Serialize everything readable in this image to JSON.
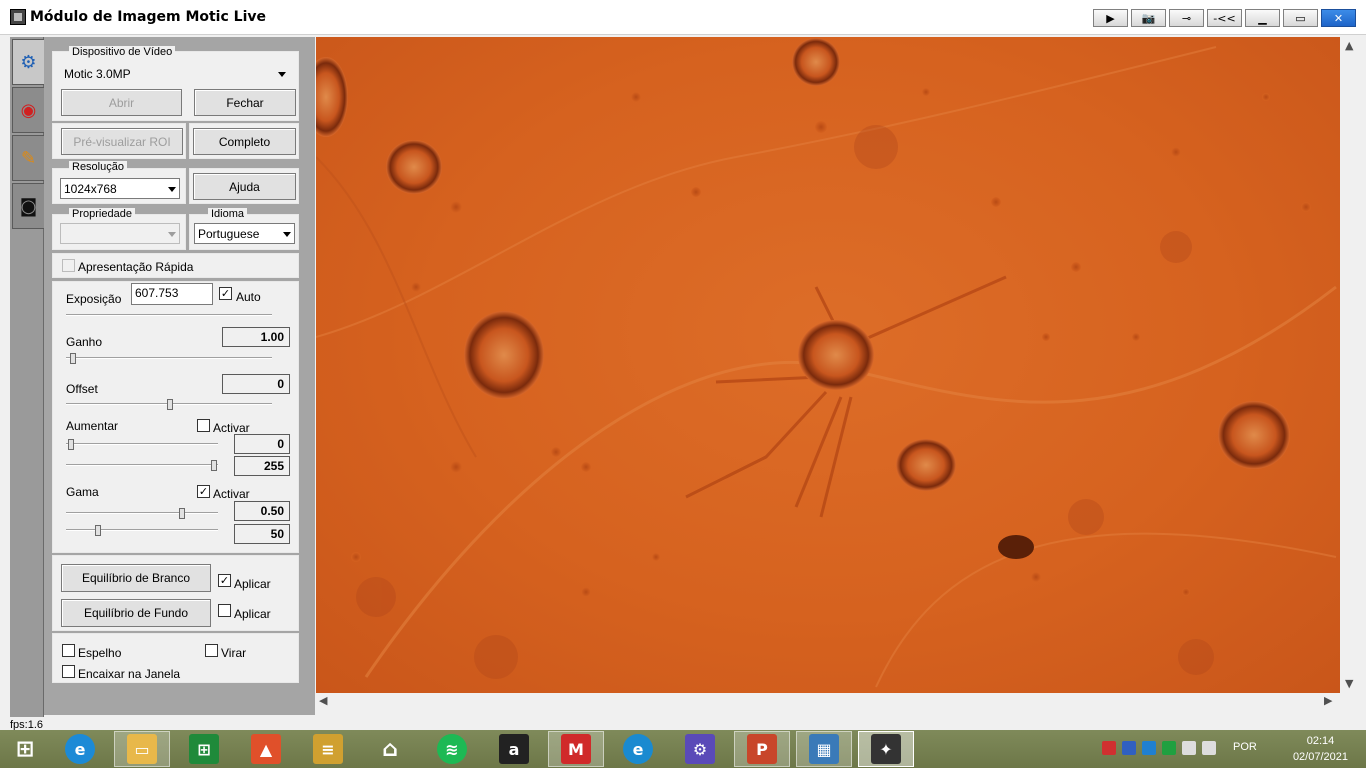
{
  "window": {
    "title": "Módulo de Imagem Motic Live",
    "buttons": [
      "play-button",
      "camera-button",
      "pin-button",
      "collapse-button",
      "minimize-button",
      "maximize-button",
      "close-button"
    ]
  },
  "tabs": [
    {
      "icon": "download-settings-icon",
      "active": true
    },
    {
      "icon": "color-wheel-icon",
      "active": false
    },
    {
      "icon": "tools-icon",
      "active": false
    },
    {
      "icon": "camera-icon",
      "active": false
    }
  ],
  "video_device": {
    "group_label": "Dispositivo de Vídeo",
    "device": "Motic 3.0MP",
    "open_label": "Abrir",
    "close_label": "Fechar",
    "roi_label": "Pré-visualizar ROI",
    "full_label": "Completo"
  },
  "resolution": {
    "group_label": "Resolução",
    "value": "1024x768",
    "help_label": "Ajuda"
  },
  "property": {
    "group_label": "Propriedade",
    "value": ""
  },
  "language": {
    "group_label": "Idioma",
    "value": "Portuguese"
  },
  "quick_display": {
    "label": "Apresentação Rápida",
    "checked": false
  },
  "exposure": {
    "label": "Exposição",
    "value": "607.753",
    "auto_label": "Auto",
    "auto_checked": true
  },
  "gain": {
    "label": "Ganho",
    "value": "1.00"
  },
  "offset": {
    "label": "Offset",
    "value": "0"
  },
  "enhance": {
    "label": "Aumentar",
    "activate_label": "Activar",
    "activate_checked": false,
    "min_value": "0",
    "max_value": "255"
  },
  "gamma": {
    "label": "Gama",
    "activate_label": "Activar",
    "activate_checked": true,
    "value1": "0.50",
    "value2": "50"
  },
  "white_balance": {
    "button_label": "Equilíbrio de Branco",
    "apply_label": "Aplicar",
    "apply_checked": true
  },
  "background_balance": {
    "button_label": "Equilíbrio de Fundo",
    "apply_label": "Aplicar",
    "apply_checked": false
  },
  "mirror": {
    "label": "Espelho",
    "checked": false
  },
  "flip": {
    "label": "Virar",
    "checked": false
  },
  "fit_window": {
    "label": "Encaixar na Janela",
    "checked": false
  },
  "status": {
    "fps": "fps:1.6"
  },
  "taskbar": {
    "apps": [
      "windows-start",
      "internet-explorer",
      "file-explorer",
      "store",
      "photos",
      "notes",
      "home",
      "spotify",
      "amazon",
      "motic-app",
      "edge",
      "settings",
      "powerpoint",
      "photo-viewer",
      "motic-live"
    ],
    "language": "POR",
    "time": "02:14",
    "date": "02/07/2021"
  }
}
